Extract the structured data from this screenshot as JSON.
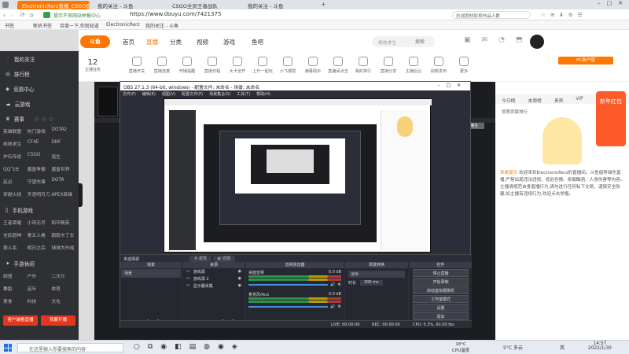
{
  "browser": {
    "tabs": [
      {
        "label": "ElectronicRerz直播_CSGO直播",
        "active": true
      },
      {
        "label": "我的关注 - 斗鱼",
        "active": false
      },
      {
        "label": "CSGO全员王者战队",
        "active": false
      },
      {
        "label": "我的关注 - 斗鱼",
        "active": false
      }
    ],
    "url": "https://www.douyu.com/7421375",
    "security": "提示不良网站举报中心",
    "right_search": "抗战题材影视作品人数",
    "bookmarks": [
      "书签",
      "新机书签",
      "百度一下,你就知道",
      "ElectronicRerz",
      "我的关注 - 斗鱼"
    ]
  },
  "douyu": {
    "nav": [
      "首页",
      "直播",
      "分类",
      "视频",
      "游戏",
      "鱼吧"
    ],
    "active_nav": "直播",
    "search_placeholder": "绝地求生",
    "search_btn": "搜索",
    "sidebar": {
      "top": [
        {
          "label": "我的关注",
          "icon": "heart-icon"
        },
        {
          "label": "排行榜",
          "icon": "rank-icon"
        },
        {
          "label": "竞猜中心",
          "icon": "quiz-icon"
        },
        {
          "label": "云游戏",
          "icon": "cloud-icon"
        },
        {
          "label": "赛事",
          "icon": "trophy-icon"
        }
      ],
      "pc_games": [
        "英雄联盟",
        "热门游戏",
        "DOTA2",
        "绝地求生",
        "CF4E",
        "DNF",
        "炉石传说",
        "CSGO",
        "逃生",
        "QQ飞车",
        "魔兽争霸",
        "魔兽世界",
        "延迟",
        "守望先锋",
        "DOTA",
        "穿越火线",
        "天涯明月刀",
        "APEX英雄"
      ],
      "mobile_section": "手机游戏",
      "mobile_games": [
        "王者荣耀",
        "小鸡无尽",
        "和平精英",
        "全民超神",
        "第五人格",
        "跑跑卡丁车",
        "狼人杀",
        "明日之后",
        "球球大作战"
      ],
      "fun_section": "手游休闲",
      "fun_games": [
        "颜值",
        "户外",
        "二次元",
        "舞蹈",
        "音乐",
        "体育",
        "美食",
        "科技",
        "文化"
      ],
      "bottom_buttons": [
        "客户端看直播",
        "我要开播"
      ]
    },
    "toolbar": [
      "主播任务",
      "直播开关",
      "直播连麦",
      "开播提醒",
      "直播日程",
      "大卡全开",
      "上升一起玩",
      "小飞楼层",
      "弹幕助手",
      "直播间点击",
      "我的排行",
      "直播分享",
      "主播后台",
      "视频发布",
      "更多"
    ],
    "level": "12",
    "right_panel": {
      "tabs": [
        "今日榜",
        "本周榜",
        "贵宾",
        "VIP"
      ],
      "notice_title": "系统提示",
      "notice": "欢迎来到ElectronicRerz的直播间。斗鱼倡导绿色直播,严禁出现违法违规、低俗色情、吸烟酗酒、人身伤害等内容。主播请规范自身直播行为,请勿进行任何私下交易、谨慎安全防骗,如主播有违规行为,欢迎点击举报。",
      "ad_label": "新年红包",
      "banner": "PC新户版"
    },
    "now_playing": "CSGO全员王者战队"
  },
  "obs": {
    "title": "OBS 27.1.3 (64-bit, windows) - 配置文件: 未命名 - 场景: 未命名",
    "menu": [
      "文件(F)",
      "编辑(E)",
      "视图(V)",
      "配置文件(P)",
      "场景集合(S)",
      "工具(T)",
      "帮助(H)"
    ],
    "no_source": "未选择源",
    "tabs_labels": [
      "属性",
      "滤镜"
    ],
    "docks": {
      "scenes": "场景",
      "sources": "来源",
      "mixer": "音频混音器",
      "transitions": "场景转换",
      "controls": "控件"
    },
    "scene_item": "场景",
    "sources": [
      "游戏源",
      "游戏源 2",
      "显示器采集"
    ],
    "mixer_channels": [
      {
        "name": "桌面音频",
        "level": "0.0 dB"
      },
      {
        "name": "麦克风/Aux",
        "level": "0.0 dB"
      }
    ],
    "transition": {
      "type": "淡出",
      "duration_label": "时长",
      "duration": "300 ms"
    },
    "controls": [
      "停止直播",
      "开始录制",
      "启动虚拟摄像机",
      "工作室模式",
      "设置",
      "退出"
    ],
    "status": {
      "live": "LIVE: 00:00:00",
      "rec": "REC: 00:00:00",
      "cpu": "CPU: 0.3%, 60.00 fps"
    }
  },
  "taskbar": {
    "search_placeholder": "在这里输入你要搜索的内容",
    "weather": "18°C",
    "weather2": "CPU温度",
    "tray_temp": "5°C 多云",
    "lang": "英",
    "time": "14:57",
    "date": "2022/1/30"
  }
}
